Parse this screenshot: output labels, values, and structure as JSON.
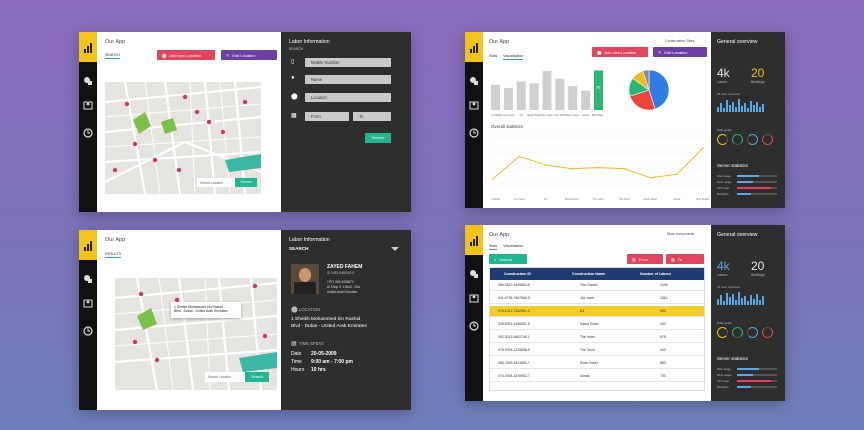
{
  "panel1": {
    "app_title": "Our App",
    "tab_search": "SEARCH",
    "add_btn": "Add new Location",
    "edit_btn": "Edit Location",
    "search_placeholder": "Search Location",
    "search_btn": "Search",
    "labor_info": "Labor Information",
    "labor_sub": "SEARCH",
    "mobile_ph": "Mobile Number",
    "name_ph": "Name",
    "location_ph": "Location",
    "from_ph": "From",
    "to_ph": "To",
    "search_btn2": "Search"
  },
  "panel2": {
    "app_title": "Our App",
    "tab_results": "RESULTS",
    "labor_info": "Labor Information",
    "search_label": "SEARCH",
    "person_name": "ZAYED FAHEM",
    "person_id": "ID 0483 5465553 8",
    "person_lines": [
      "+971 056 4405870",
      "Al Shop 3, 1 Blo3 - Sho",
      "United Arab Emirates"
    ],
    "location_label": "LOCATION",
    "location_text1": "1 Sheikh Mohammed bin Rashid",
    "location_text2": "Blvd - Dubai - United Arab Emirates",
    "time_label": "TIME SPENT",
    "date_k": "Date",
    "date_v": "20-05-2009",
    "time_k": "Time",
    "time_v": "9:00 am - 7:00 pm",
    "hours_k": "Hours",
    "hours_v": "10 hrs",
    "map_popup1": "1 Sheikh Mohammed bin Rashid",
    "map_popup2": "Blvd - Dubai - United Arab Emirates",
    "search_placeholder": "Search Location",
    "search_btn": "Search"
  },
  "panel3": {
    "app_title": "Our App",
    "construction_sites": "Construction Sites",
    "tab_stats": "Stats",
    "tab_vis": "Visualisation",
    "add_btn": "Add new Location",
    "edit_btn": "Edit Location",
    "overall": "Overall statistics",
    "bar_highlight": "86",
    "general": "General overview",
    "labors_num": "4k",
    "labors_lbl": "Labors",
    "buildings_num": "20",
    "buildings_lbl": "Buildings",
    "overview_24": "24 hour overview",
    "daily_goals": "Daily goals",
    "server_stats": "Server statistics",
    "server_items": [
      "Disk usage",
      "Mem usage",
      "CPU load",
      "Bandwith"
    ]
  },
  "panel4": {
    "app_title": "Our App",
    "more_components": "More components",
    "tab_stats": "Stats",
    "tab_vis": "Visualisation",
    "search_btn": "Search",
    "from_btn": "From",
    "to_btn": "To",
    "col1": "Construction ID",
    "col2": "Construction Name",
    "col3": "Number of Labors",
    "general": "General overview",
    "labors_num": "4k",
    "labors_lbl": "Labors",
    "buildings_num": "20",
    "buildings_lbl": "Buildings",
    "overview_24": "24 hour overview",
    "daily_goals": "Daily goals",
    "server_stats": "Server statistics",
    "server_items": [
      "Disk usage",
      "Mem usage",
      "CPU load",
      "Bandwith"
    ],
    "rows": [
      {
        "id": "056-0462-5449854-8",
        "name": "The Citadel",
        "labors": "1046"
      },
      {
        "id": "041-4736-7667866-9",
        "name": "JAL hotel",
        "labors": "1810"
      },
      {
        "id": "078-1012-7462861-4",
        "name": "D1",
        "labors": "855"
      },
      {
        "id": "048-5991-4456651-5",
        "name": "Sama Tower",
        "labors": "400"
      },
      {
        "id": "002-3013-5692748-1",
        "name": "The Index",
        "labors": "678"
      },
      {
        "id": "078-9765-1225536-8",
        "name": "The Torch",
        "labors": "340"
      },
      {
        "id": "055-7599-4524895-7",
        "name": "Rose Tower",
        "labors": "880"
      },
      {
        "id": "074-0058-1876952-7",
        "name": "Almas",
        "labors": "730"
      }
    ]
  },
  "chart_data": {
    "type": "line",
    "title": "Overall statistics",
    "categories": [
      "The Citadel",
      "JAL hotel",
      "D1",
      "Sama Tower",
      "The Index",
      "The Torch",
      "Rose Tower",
      "Almas",
      "Burj Khalifa"
    ],
    "values": [
      20,
      60,
      45,
      38,
      40,
      38,
      22,
      28,
      75
    ],
    "bar_values": [
      55,
      48,
      62,
      58,
      85,
      68,
      52,
      42,
      86
    ],
    "pie_values": [
      45,
      25,
      15,
      10,
      5
    ],
    "pie_colors": [
      "#2f7de1",
      "#e8453c",
      "#2bb673",
      "#f5b820",
      "#8a8a8a"
    ]
  }
}
